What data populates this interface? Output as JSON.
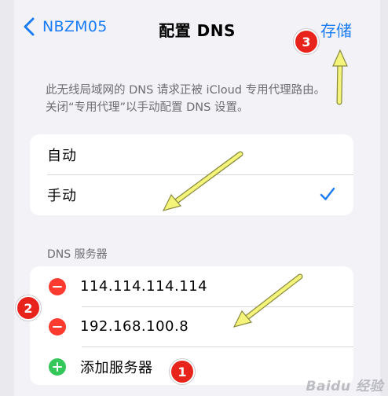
{
  "nav": {
    "back_label": "NBZM05",
    "title": "配置 DNS",
    "save_label": "存储"
  },
  "info_text": "此无线局域网的 DNS 请求正被 iCloud 专用代理路由。关闭“专用代理”以手动配置 DNS 设置。",
  "mode_options": [
    {
      "label": "自动",
      "selected": false
    },
    {
      "label": "手动",
      "selected": true
    }
  ],
  "dns_section": {
    "header": "DNS 服务器",
    "servers": [
      "114.114.114.114",
      "192.168.100.8"
    ],
    "add_label": "添加服务器"
  },
  "annotations": {
    "markers": [
      "1",
      "2",
      "3"
    ]
  },
  "watermark": "Baidu 经验",
  "colors": {
    "accent": "#1a7cf5",
    "delete": "#ff3b30",
    "add": "#34c759",
    "arrow": "#f4f47a",
    "marker": "#e8231c"
  }
}
